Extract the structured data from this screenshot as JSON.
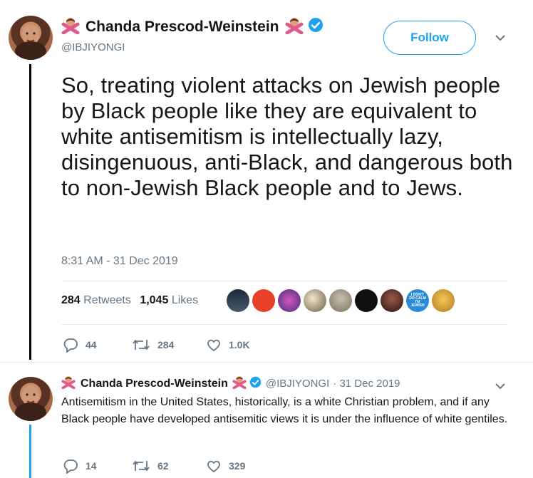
{
  "main_tweet": {
    "author_name": "Chanda Prescod-Weinstein",
    "handle": "@IBJIYONGI",
    "follow_label": "Follow",
    "text": "So, treating violent attacks on Jewish people by Black people like they are equivalent to white antisemitism is intellectually lazy, disingenuous, anti-Black, and dangerous both to non-Jewish Black people and to Jews.",
    "timestamp": "8:31 AM - 31 Dec 2019",
    "retweet_count": "284",
    "retweets_label": "Retweets",
    "like_count": "1,045",
    "likes_label": "Likes",
    "actions": {
      "replies": "44",
      "retweets": "284",
      "likes": "1.0K"
    },
    "badge_text": "I DON'T DO CALM I'M JEWISH"
  },
  "reply_tweet": {
    "author_name": "Chanda Prescod-Weinstein",
    "handle": "@IBJIYONGI",
    "date": "· 31 Dec 2019",
    "text": "Antisemitism in the United States, historically, is a white Christian problem, and if any Black people have developed antisemitic views it is under the influence of white gentiles.",
    "actions": {
      "replies": "14",
      "retweets": "62",
      "likes": "329"
    }
  },
  "colors": {
    "accent": "#1da1f2",
    "text": "#14171a",
    "secondary": "#657786",
    "thread": "#1da1f2"
  },
  "icons": [
    "person-gesturing-no-emoji",
    "verified-badge-icon",
    "chevron-down-icon",
    "reply-icon",
    "retweet-icon",
    "like-heart-icon"
  ]
}
